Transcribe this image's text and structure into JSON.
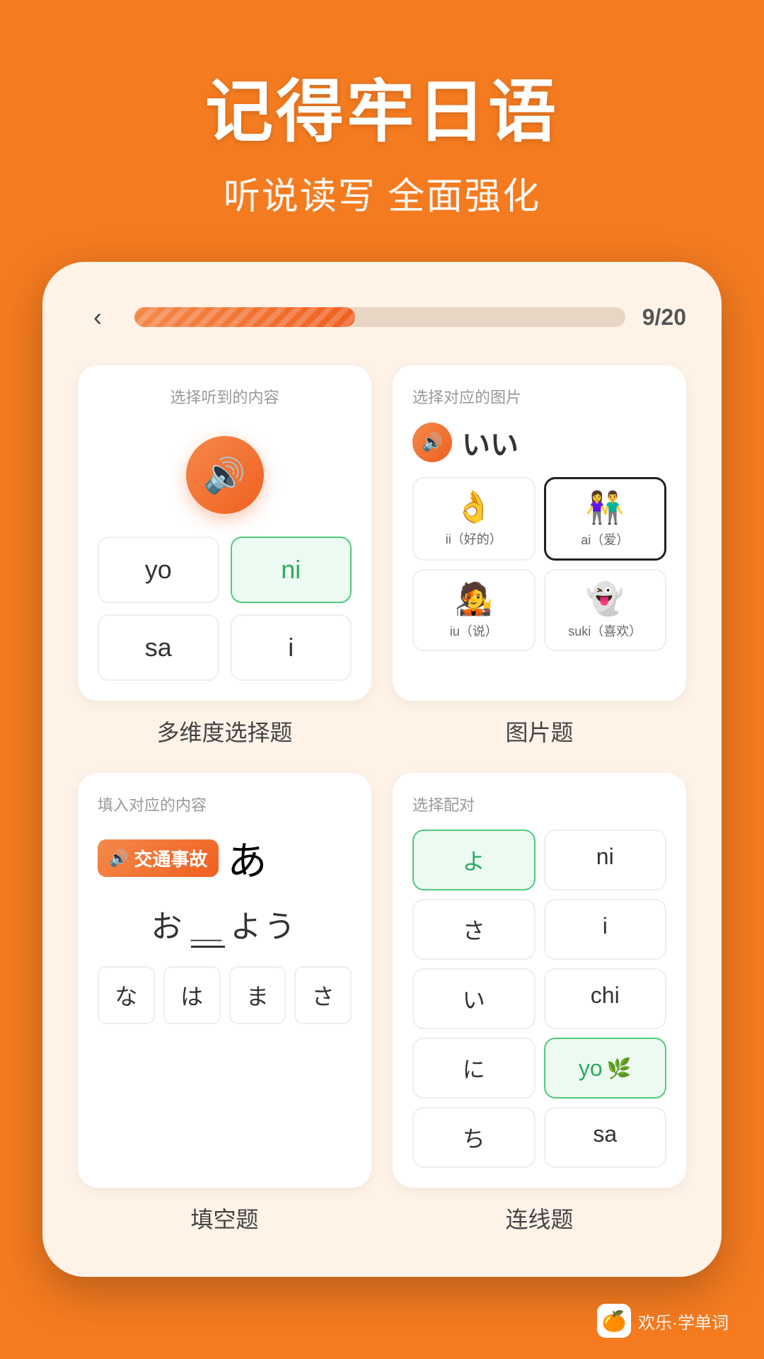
{
  "header": {
    "title": "记得牢日语",
    "subtitle": "听说读写 全面强化"
  },
  "progress": {
    "current": 9,
    "total": 20,
    "label": "9/20",
    "percent": 45,
    "back_label": "‹"
  },
  "top_left_card": {
    "card_label": "选择听到的内容",
    "choices": [
      {
        "text": "yo",
        "selected": false
      },
      {
        "text": "ni",
        "selected": true
      },
      {
        "text": "sa",
        "selected": false
      },
      {
        "text": "i",
        "selected": false
      }
    ]
  },
  "top_right_card": {
    "card_label": "选择对应的图片",
    "audio_text": "いい",
    "pictures": [
      {
        "emoji": "👌",
        "caption": "ii（好的）",
        "selected": false
      },
      {
        "emoji": "👫",
        "caption": "ai（爱）",
        "selected": true
      },
      {
        "emoji": "🧑",
        "caption": "iu（说）",
        "selected": false
      },
      {
        "emoji": "👻",
        "caption": "suki（喜欢）",
        "selected": false
      }
    ]
  },
  "labels_row1": {
    "left": "多维度选择题",
    "right": "图片题"
  },
  "bottom_left_card": {
    "card_label": "填入对应的内容",
    "word": "交通事故",
    "sentence_parts": [
      "お",
      "よう"
    ],
    "blank_position": "middle",
    "keys": [
      "な",
      "は",
      "ま",
      "さ"
    ]
  },
  "bottom_right_card": {
    "card_label": "选择配对",
    "pairs_left": [
      "よ",
      "さ",
      "い",
      "に",
      "ち"
    ],
    "pairs_right": [
      "ni",
      "i",
      "chi",
      "yo",
      "sa"
    ],
    "selected_left": "に",
    "selected_right": "yo"
  },
  "labels_row2": {
    "left": "填空题",
    "right": "连线题"
  },
  "watermark": {
    "text": "欢乐·学单词",
    "icon": "🍊"
  }
}
